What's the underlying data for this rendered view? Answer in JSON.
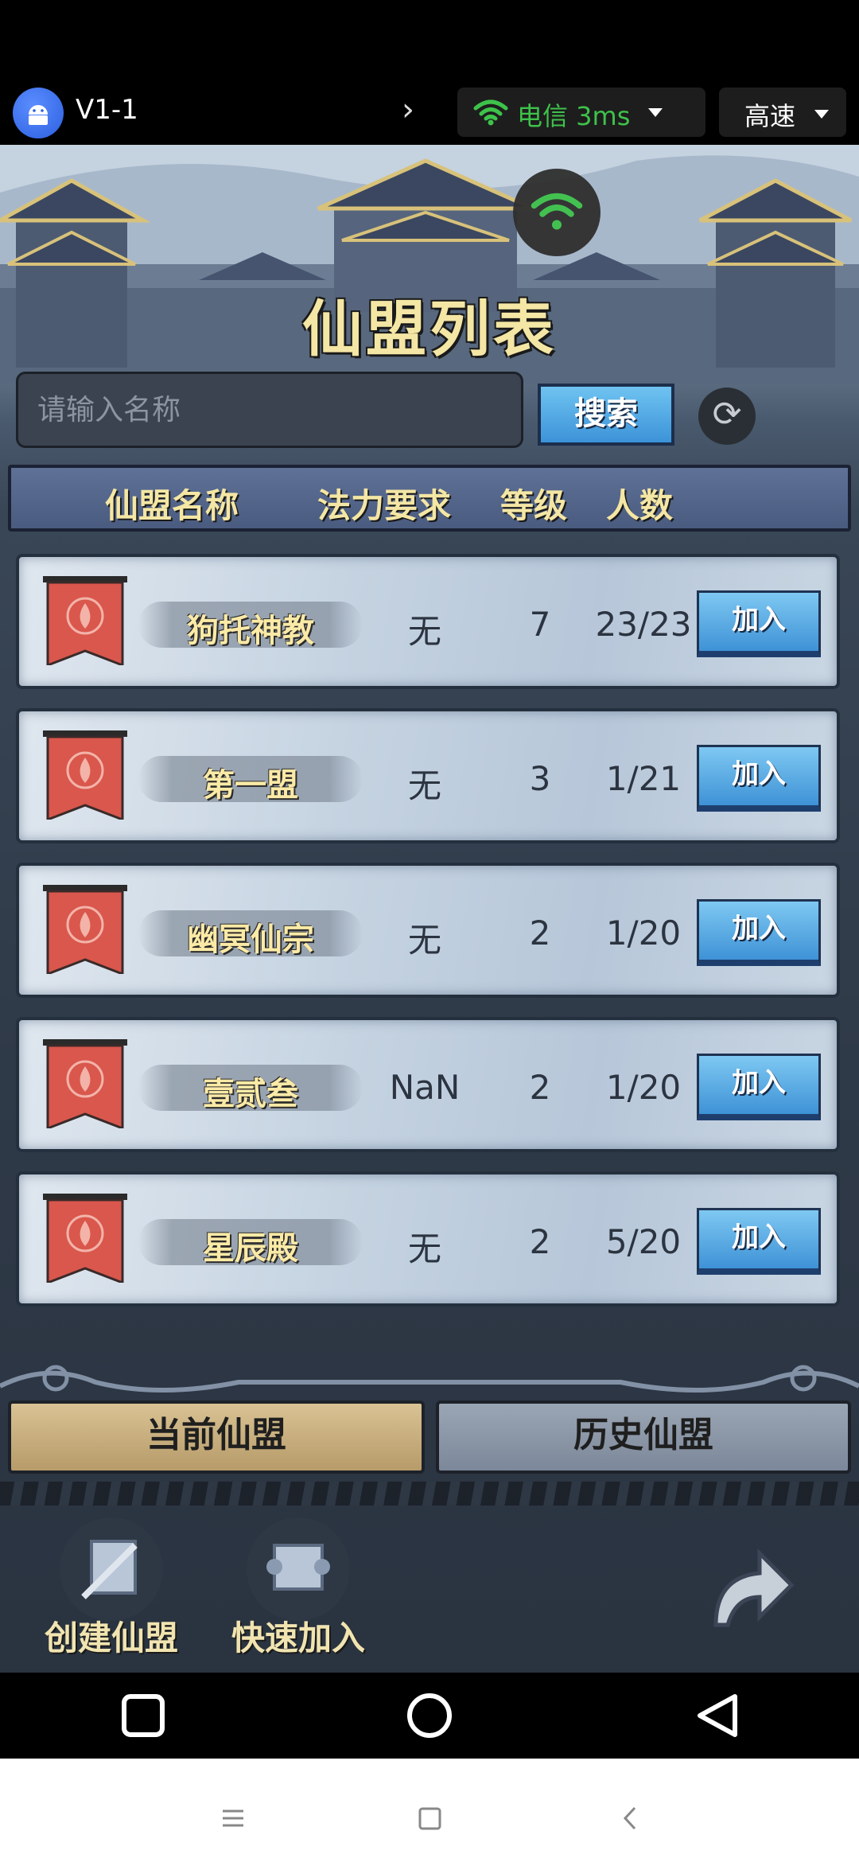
{
  "emulator_bar": {
    "app_title": "V1-1",
    "network_label": "电信 3ms",
    "speed_label": "高速"
  },
  "game": {
    "title": "仙盟列表",
    "search": {
      "placeholder": "请输入名称",
      "button_label": "搜索"
    },
    "columns": {
      "name": "仙盟名称",
      "requirement": "法力要求",
      "level": "等级",
      "count": "人数"
    },
    "alliances": [
      {
        "name": "狗托神教",
        "requirement": "无",
        "level": "7",
        "count": "23/23",
        "join_label": "加入"
      },
      {
        "name": "第一盟",
        "requirement": "无",
        "level": "3",
        "count": "1/21",
        "join_label": "加入"
      },
      {
        "name": "幽冥仙宗",
        "requirement": "无",
        "level": "2",
        "count": "1/20",
        "join_label": "加入"
      },
      {
        "name": "壹贰叁",
        "requirement": "NaN",
        "level": "2",
        "count": "1/20",
        "join_label": "加入"
      },
      {
        "name": "星辰殿",
        "requirement": "无",
        "level": "2",
        "count": "5/20",
        "join_label": "加入"
      }
    ],
    "tabs": {
      "current": "当前仙盟",
      "history": "历史仙盟"
    },
    "actions": {
      "create": "创建仙盟",
      "quick_join": "快速加入"
    }
  },
  "colors": {
    "title_gold": "#f4e6a4",
    "join_blue": "#3e92d6",
    "banner_red": "#d9574c",
    "wifi_green": "#3ec24a"
  }
}
